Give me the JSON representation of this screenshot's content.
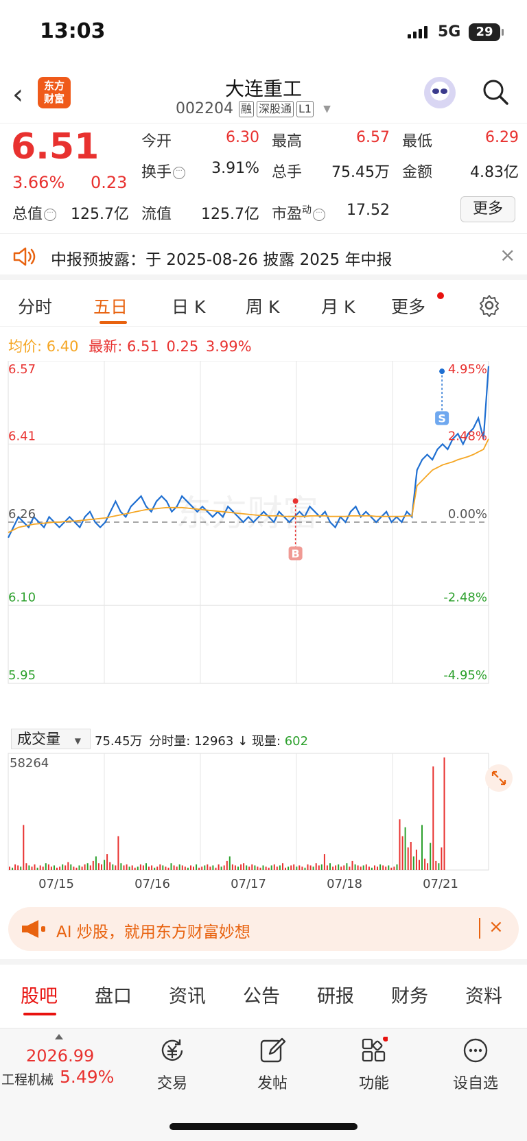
{
  "status": {
    "time": "13:03",
    "network": "5G",
    "battery": "29"
  },
  "header": {
    "logo_line1": "东方",
    "logo_line2": "财富",
    "name": "大连重工",
    "code": "002204",
    "tags": [
      "融",
      "深股通",
      "L1"
    ]
  },
  "quote": {
    "price": "6.51",
    "change_pct": "3.66%",
    "change": "0.23",
    "open_label": "今开",
    "open": "6.30",
    "high_label": "最高",
    "high": "6.57",
    "low_label": "最低",
    "low": "6.29",
    "turnover_label": "换手",
    "turnover": "3.91%",
    "volume_label": "总手",
    "volume": "75.45万",
    "amount_label": "金额",
    "amount": "4.83亿",
    "mktcap_label": "总值",
    "mktcap": "125.7亿",
    "float_label": "流值",
    "float": "125.7亿",
    "pe_label": "市盈",
    "pe_sup": "动",
    "pe": "17.52",
    "more": "更多"
  },
  "notice": {
    "text": "中报预披露：于 2025-08-26 披露 2025 年中报"
  },
  "tabs": [
    "分时",
    "五日",
    "日 K",
    "周 K",
    "月 K",
    "更多"
  ],
  "active_tab": "五日",
  "info": {
    "avg_label": "均价:",
    "avg": "6.40",
    "last_label": "最新:",
    "last": "6.51",
    "chg": "0.25",
    "pct": "3.99%"
  },
  "chart_data": {
    "type": "line",
    "title": "",
    "x": [
      "07/15",
      "07/16",
      "07/17",
      "07/18",
      "07/21"
    ],
    "ylim": [
      5.95,
      6.57
    ],
    "y_ticks_left": [
      "6.57",
      "6.41",
      "6.26",
      "6.10",
      "5.95"
    ],
    "y_ticks_right": [
      "4.95%",
      "2.48%",
      "0.00%",
      "-2.48%",
      "-4.95%"
    ],
    "prev_close": 6.26,
    "series": [
      {
        "name": "",
        "color": "#1f6fd1",
        "values": [
          6.23,
          6.25,
          6.27,
          6.26,
          6.25,
          6.27,
          6.26,
          6.25,
          6.27,
          6.26,
          6.25,
          6.26,
          6.27,
          6.26,
          6.25,
          6.27,
          6.28,
          6.26,
          6.25,
          6.26,
          6.28,
          6.3,
          6.28,
          6.27,
          6.29,
          6.3,
          6.31,
          6.29,
          6.28,
          6.3,
          6.31,
          6.3,
          6.28,
          6.29,
          6.31,
          6.3,
          6.29,
          6.28,
          6.29,
          6.28,
          6.27,
          6.28,
          6.27,
          6.29,
          6.28,
          6.27,
          6.26,
          6.27,
          6.26,
          6.27,
          6.28,
          6.27,
          6.26,
          6.28,
          6.27,
          6.26,
          6.27,
          6.28,
          6.27,
          6.29,
          6.28,
          6.27,
          6.28,
          6.26,
          6.25,
          6.27,
          6.26,
          6.28,
          6.29,
          6.27,
          6.28,
          6.27,
          6.26,
          6.27,
          6.28,
          6.26,
          6.27,
          6.26,
          6.28,
          6.27,
          6.36,
          6.38,
          6.39,
          6.38,
          6.4,
          6.41,
          6.4,
          6.42,
          6.43,
          6.41,
          6.43,
          6.44,
          6.46,
          6.42,
          6.56
        ]
      },
      {
        "name": "",
        "color": "#f5a623",
        "values": [
          6.24,
          6.245,
          6.25,
          6.252,
          6.254,
          6.256,
          6.257,
          6.258,
          6.259,
          6.26,
          6.26,
          6.261,
          6.262,
          6.262,
          6.263,
          6.264,
          6.265,
          6.266,
          6.267,
          6.268,
          6.27,
          6.272,
          6.274,
          6.276,
          6.278,
          6.28,
          6.282,
          6.284,
          6.285,
          6.286,
          6.287,
          6.288,
          6.288,
          6.288,
          6.288,
          6.287,
          6.286,
          6.285,
          6.284,
          6.283,
          6.282,
          6.281,
          6.28,
          6.279,
          6.278,
          6.277,
          6.276,
          6.275,
          6.274,
          6.273,
          6.273,
          6.272,
          6.272,
          6.272,
          6.271,
          6.271,
          6.271,
          6.271,
          6.271,
          6.272,
          6.272,
          6.272,
          6.272,
          6.271,
          6.271,
          6.271,
          6.271,
          6.272,
          6.272,
          6.272,
          6.272,
          6.272,
          6.271,
          6.271,
          6.271,
          6.271,
          6.271,
          6.271,
          6.272,
          6.272,
          6.33,
          6.34,
          6.35,
          6.36,
          6.365,
          6.37,
          6.373,
          6.376,
          6.38,
          6.383,
          6.386,
          6.39,
          6.395,
          6.4,
          6.42
        ]
      }
    ],
    "markers": [
      {
        "label": "B",
        "x_day": 3,
        "y": 6.29
      },
      {
        "label": "S",
        "x_day": 5,
        "y": 6.49
      }
    ],
    "watermark": "东方财富"
  },
  "volume": {
    "selector": "成交量",
    "total": "75.45万",
    "minute_label": "分时量:",
    "minute": "12963",
    "now_label": "现量:",
    "now": "602",
    "max_tick": "58264",
    "values": [
      3,
      2,
      5,
      4,
      3,
      40,
      6,
      4,
      3,
      5,
      2,
      4,
      3,
      6,
      5,
      3,
      4,
      2,
      3,
      5,
      4,
      7,
      5,
      3,
      2,
      4,
      3,
      5,
      6,
      4,
      8,
      12,
      6,
      5,
      9,
      14,
      7,
      5,
      4,
      30,
      6,
      4,
      5,
      3,
      4,
      2,
      3,
      5,
      4,
      6,
      3,
      4,
      2,
      3,
      5,
      4,
      3,
      2,
      6,
      4,
      3,
      5,
      4,
      3,
      2,
      4,
      3,
      5,
      2,
      3,
      4,
      5,
      3,
      4,
      2,
      5,
      3,
      4,
      8,
      12,
      5,
      4,
      3,
      5,
      6,
      4,
      3,
      5,
      4,
      3,
      2,
      4,
      3,
      2,
      4,
      5,
      3,
      4,
      6,
      2,
      3,
      4,
      5,
      3,
      4,
      3,
      2,
      5,
      4,
      3,
      6,
      4,
      5,
      14,
      4,
      6,
      3,
      4,
      5,
      3,
      4,
      6,
      3,
      8,
      5,
      4,
      3,
      4,
      5,
      3,
      2,
      4,
      3,
      5,
      4,
      3,
      4,
      2,
      3,
      5,
      45,
      30,
      38,
      20,
      25,
      12,
      18,
      9,
      40,
      10,
      6,
      24,
      92,
      8,
      6,
      20,
      100
    ],
    "colors_up": "#e8312f",
    "colors_down": "#2ca02c"
  },
  "ai_banner": {
    "text": "AI 炒股，就用东方财富妙想"
  },
  "subtabs": [
    "股吧",
    "盘口",
    "资讯",
    "公告",
    "研报",
    "财务",
    "资料"
  ],
  "bottom": {
    "index_value": "2026.99",
    "index_name": "工程机械",
    "index_pct": "5.49%",
    "nav": [
      "交易",
      "发帖",
      "功能",
      "设自选"
    ]
  }
}
